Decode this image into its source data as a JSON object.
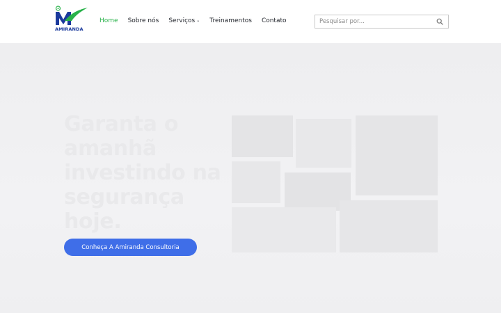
{
  "header": {
    "logo": {
      "text": "AMIRANDA",
      "icon": "amiranda-m-logo",
      "colors": {
        "green": "#29b24a",
        "blue": "#1b3a9c"
      }
    },
    "nav": [
      {
        "label": "Home",
        "active": true
      },
      {
        "label": "Sobre nós",
        "active": false
      },
      {
        "label": "Serviços",
        "active": false,
        "has_dropdown": true
      },
      {
        "label": "Treinamentos",
        "active": false
      },
      {
        "label": "Contato",
        "active": false
      }
    ],
    "search": {
      "placeholder": "Pesquisar por...",
      "value": "",
      "icon": "search-icon"
    }
  },
  "hero": {
    "title": "Garanta o amanhã investindo na segurança hoje.",
    "cta_label": "Conheça A Amiranda Consultoria",
    "image_icon": "hero-image"
  },
  "colors": {
    "accent_green": "#29b24a",
    "cta_blue": "#3f6ee8",
    "nav_text": "#23262d"
  }
}
